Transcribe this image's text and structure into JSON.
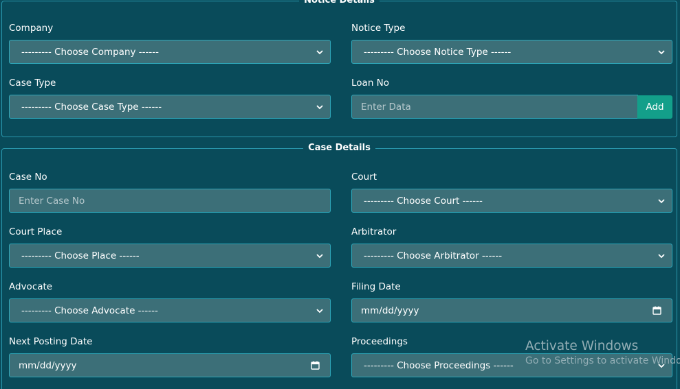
{
  "notice_details": {
    "legend": "Notice Details",
    "company": {
      "label": "Company",
      "value": "--------- Choose Company ------"
    },
    "notice_type": {
      "label": "Notice Type",
      "value": "--------- Choose Notice Type ------"
    },
    "case_type": {
      "label": "Case Type",
      "value": "--------- Choose Case Type ------"
    },
    "loan_no": {
      "label": "Loan No",
      "placeholder": "Enter Data",
      "button": "Add"
    }
  },
  "case_details": {
    "legend": "Case Details",
    "case_no": {
      "label": "Case No",
      "placeholder": "Enter Case No"
    },
    "court": {
      "label": "Court",
      "value": "--------- Choose Court ------"
    },
    "court_place": {
      "label": "Court Place",
      "value": "--------- Choose Place ------"
    },
    "arbitrator": {
      "label": "Arbitrator",
      "value": "--------- Choose Arbitrator ------"
    },
    "advocate": {
      "label": "Advocate",
      "value": "--------- Choose Advocate ------"
    },
    "filing_date": {
      "label": "Filing Date",
      "value": "mm/dd/yyyy"
    },
    "next_posting_date": {
      "label": "Next Posting Date",
      "value": "mm/dd/yyyy"
    },
    "proceedings": {
      "label": "Proceedings",
      "value": "--------- Choose Proceedings ------"
    }
  },
  "watermark": {
    "title": "Activate Windows",
    "subtitle": "Go to Settings to activate Windows."
  },
  "icons": {
    "select_caret": "chevron-down-icon",
    "date_picker": "calendar-icon"
  },
  "colors": {
    "background": "#094b5a",
    "control_fill": "#3c6f78",
    "control_border": "#2fa7b9",
    "add_button": "#139f8a"
  }
}
